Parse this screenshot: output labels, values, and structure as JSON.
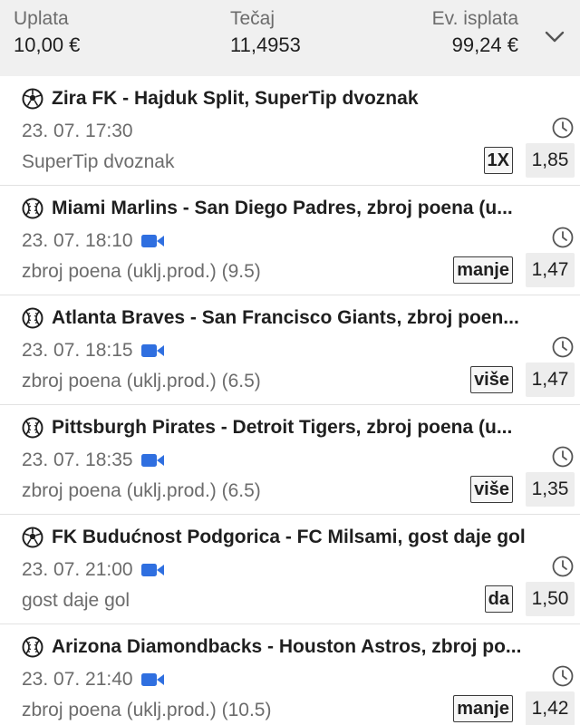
{
  "summary": {
    "stake_label": "Uplata",
    "stake_value": "10,00 €",
    "odds_label": "Tečaj",
    "odds_value": "11,4953",
    "payout_label": "Ev. isplata",
    "payout_value": "99,24 €",
    "collapse_icon": "chevron-down-icon"
  },
  "colors": {
    "summary_bg": "#f0f0f0",
    "video_icon": "#2f6fe0",
    "odd_box_bg": "#ededed"
  },
  "bets": [
    {
      "sport_icon": "soccer-ball-icon",
      "title": "Zira FK - Hajduk Split, SuperTip dvoznak",
      "time": "23. 07. 17:30",
      "live_video": false,
      "market": "SuperTip dvoznak",
      "pick": "1X",
      "odd": "1,85"
    },
    {
      "sport_icon": "baseball-icon",
      "title": "Miami Marlins - San Diego Padres, zbroj poena (u...",
      "time": "23. 07. 18:10",
      "live_video": true,
      "market": "zbroj poena (uklj.prod.) (9.5)",
      "pick": "manje",
      "odd": "1,47"
    },
    {
      "sport_icon": "baseball-icon",
      "title": "Atlanta Braves - San Francisco Giants, zbroj poen...",
      "time": "23. 07. 18:15",
      "live_video": true,
      "market": "zbroj poena (uklj.prod.) (6.5)",
      "pick": "više",
      "odd": "1,47"
    },
    {
      "sport_icon": "baseball-icon",
      "title": "Pittsburgh Pirates - Detroit Tigers, zbroj poena (u...",
      "time": "23. 07. 18:35",
      "live_video": true,
      "market": "zbroj poena (uklj.prod.) (6.5)",
      "pick": "više",
      "odd": "1,35"
    },
    {
      "sport_icon": "soccer-ball-icon",
      "title": "FK Budućnost Podgorica - FC Milsami, gost daje gol",
      "time": "23. 07. 21:00",
      "live_video": true,
      "market": "gost daje gol",
      "pick": "da",
      "odd": "1,50"
    },
    {
      "sport_icon": "baseball-icon",
      "title": "Arizona Diamondbacks - Houston Astros, zbroj po...",
      "time": "23. 07. 21:40",
      "live_video": true,
      "market": "zbroj poena (uklj.prod.) (10.5)",
      "pick": "manje",
      "odd": "1,42"
    }
  ]
}
